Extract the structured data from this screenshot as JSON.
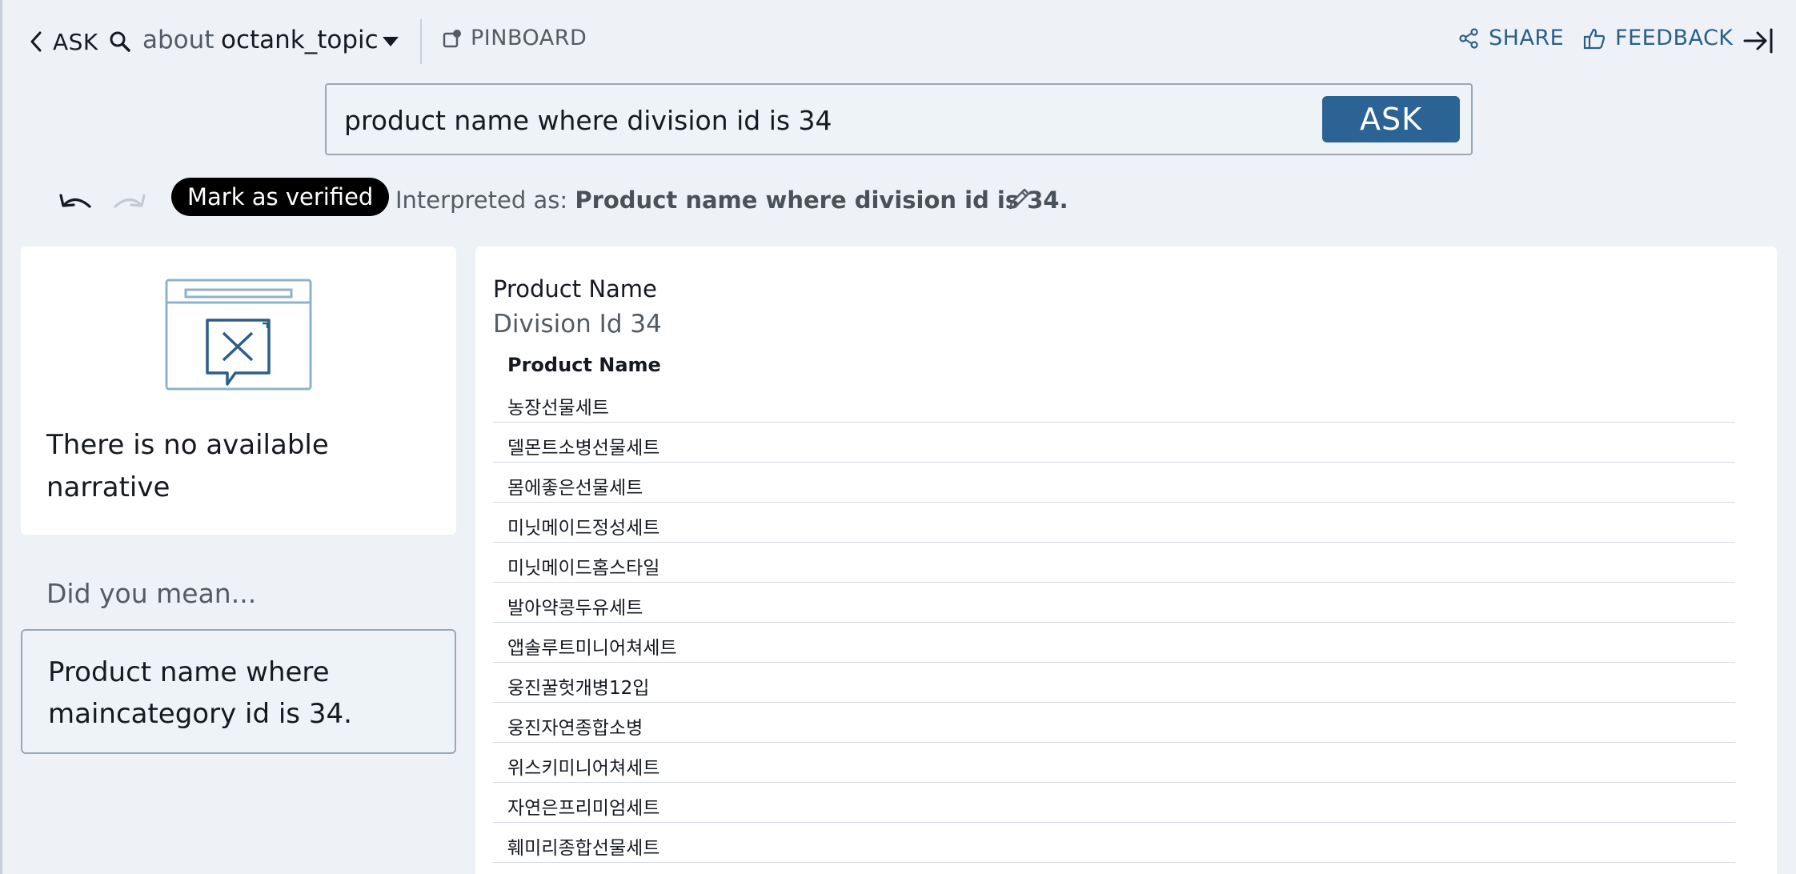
{
  "header": {
    "back_label": "ASK",
    "about_label": "about",
    "topic": "octank_topic",
    "pinboard_label": "PINBOARD",
    "share_label": "SHARE",
    "feedback_label": "FEEDBACK"
  },
  "query": {
    "value": "product name where division id is 34",
    "ask_button": "ASK"
  },
  "toolbar": {
    "verify_label": "Mark as verified",
    "interpreted_prefix": "Interpreted as:",
    "interpreted_value": "Product name where division id is 34."
  },
  "narrative": {
    "message": "There is no available narrative"
  },
  "did_you_mean": {
    "label": "Did you mean...",
    "suggestion": "Product name where maincategory id is 34."
  },
  "result": {
    "title": "Product Name",
    "subtitle": "Division Id 34",
    "column_header": "Product Name",
    "rows": [
      "농장선물세트",
      "델몬트소병선물세트",
      "몸에좋은선물세트",
      "미닛메이드정성세트",
      "미닛메이드홈스타일",
      "발아약콩두유세트",
      "앱솔루트미니어쳐세트",
      "웅진꿀헛개병12입",
      "웅진자연종합소병",
      "위스키미니어쳐세트",
      "자연은프리미엄세트",
      "훼미리종합선물세트"
    ]
  },
  "icons": {
    "back": "chevron-left-icon",
    "search": "search-icon",
    "topic_dropdown": "caret-down-icon",
    "pinboard": "pinboard-icon",
    "share": "share-icon",
    "feedback": "thumbs-up-icon",
    "collapse": "collapse-panel-icon",
    "undo": "undo-icon",
    "redo": "redo-icon",
    "edit": "pencil-icon",
    "no_narrative": "no-narrative-illustration-icon"
  },
  "colors": {
    "accent": "#2b6494",
    "link": "#2b5f8a",
    "background": "#eef2f6"
  }
}
